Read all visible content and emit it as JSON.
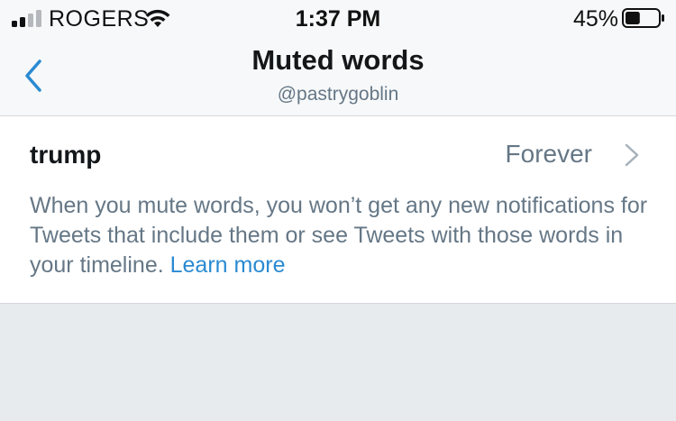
{
  "status_bar": {
    "carrier": "ROGERS",
    "time": "1:37 PM",
    "battery_percent": "45%",
    "battery_level": 0.45,
    "signal_bars": 2,
    "icons": [
      "signal-icon",
      "wifi-icon",
      "battery-icon"
    ]
  },
  "header": {
    "title": "Muted words",
    "subtitle": "@pastrygoblin",
    "back_icon": "chevron-left-icon"
  },
  "muted_words": [
    {
      "word": "trump",
      "duration": "Forever",
      "icon": "chevron-right-icon"
    }
  ],
  "description": {
    "text": "When you mute words, you won’t get any new notifications for Tweets that include them or see Tweets with those words in your timeline.",
    "link": "Learn more"
  },
  "colors": {
    "accent": "#2a8ad2",
    "secondary_text": "#657786",
    "primary_text": "#14171a",
    "background": "#e8ebee"
  }
}
